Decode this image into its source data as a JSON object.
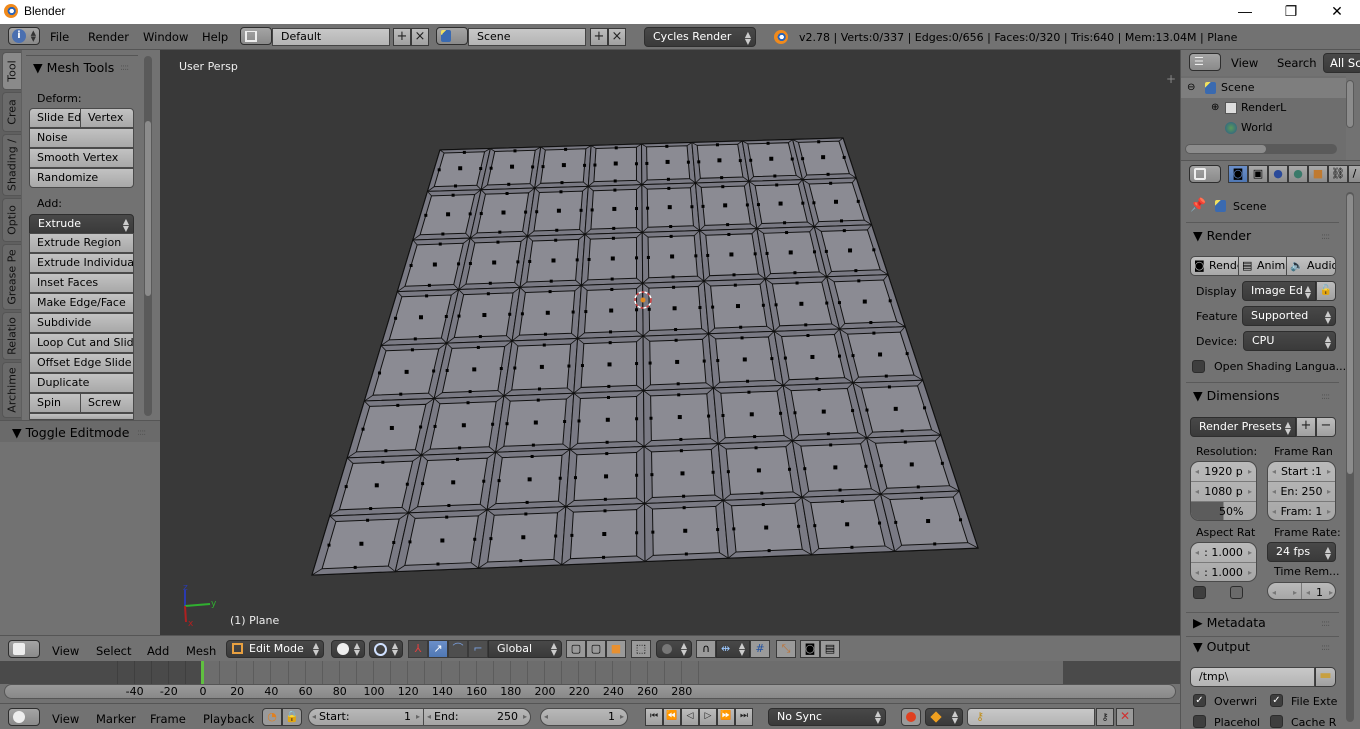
{
  "window": {
    "title": "Blender",
    "minimize": "—",
    "maximize": "❐",
    "close": "✕"
  },
  "topbar": {
    "menus": [
      "File",
      "Render",
      "Window",
      "Help"
    ],
    "layout": "Default",
    "scene": "Scene",
    "engine": "Cycles Render",
    "stats": "v2.78 | Verts:0/337 | Edges:0/656 | Faces:0/320 | Tris:640 | Mem:13.04M | Plane"
  },
  "toolshelf": {
    "tabs": [
      "Tool",
      "Crea",
      "Shading /",
      "Optio",
      "Grease Pe",
      "Relatio",
      "Archime"
    ],
    "panel_title": "Mesh Tools",
    "deform_label": "Deform:",
    "deform_buttons": [
      "Slide Ed",
      "Vertex",
      "Noise",
      "Smooth Vertex",
      "Randomize"
    ],
    "add_label": "Add:",
    "extrude_select": "Extrude",
    "add_buttons": [
      "Extrude Region",
      "Extrude Individual",
      "Inset Faces",
      "Make Edge/Face",
      "Subdivide",
      "Loop Cut and Slide",
      "Offset Edge Slide",
      "Duplicate"
    ],
    "spin": "Spin",
    "screw": "Screw",
    "toggle_editmode": "Toggle Editmode"
  },
  "viewport": {
    "view_label": "User Persp",
    "object_label": "(1) Plane",
    "axis": {
      "x": "x",
      "y": "y",
      "z": "z"
    }
  },
  "viewport_header": {
    "menus": [
      "View",
      "Select",
      "Add",
      "Mesh"
    ],
    "mode": "Edit Mode",
    "orientation": "Global"
  },
  "timeline": {
    "ticks": [
      "-40",
      "-20",
      "0",
      "20",
      "40",
      "60",
      "80",
      "100",
      "120",
      "140",
      "160",
      "180",
      "200",
      "220",
      "240",
      "260",
      "280"
    ],
    "current_frame": 0,
    "menus": [
      "View",
      "Marker",
      "Frame",
      "Playback"
    ],
    "start_label": "Start:",
    "start_value": "1",
    "end_label": "End:",
    "end_value": "250",
    "frame_value": "1",
    "sync": "No Sync"
  },
  "outliner": {
    "menus": [
      "View",
      "Search"
    ],
    "filter": "All Sc",
    "items": [
      "Scene",
      "RenderL",
      "World"
    ]
  },
  "properties": {
    "context": "Scene",
    "render_panel": {
      "title": "Render",
      "buttons": [
        "Rende",
        "Anima",
        "Audio"
      ],
      "display_label": "Display",
      "display_value": "Image Ed",
      "feature_label": "Feature",
      "feature_value": "Supported",
      "device_label": "Device:",
      "device_value": "CPU",
      "osl_label": "Open Shading Langua..."
    },
    "dimensions_panel": {
      "title": "Dimensions",
      "presets": "Render Presets",
      "resolution_label": "Resolution:",
      "res_x": "1920 p",
      "res_y": "1080 p",
      "res_pct": "50%",
      "res_pct_value": 0.5,
      "frame_range_label": "Frame Ran",
      "start": "Start :1",
      "end": "En: 250",
      "frame_step": "Fram: 1",
      "aspect_label": "Aspect Rat",
      "aspect_x": ": 1.000",
      "aspect_y": ": 1.000",
      "frame_rate_label": "Frame Rate:",
      "frame_rate": "24 fps",
      "time_remap_label": "Time Rem...",
      "time_remap_value": "1"
    },
    "metadata_title": "Metadata",
    "output_panel": {
      "title": "Output",
      "path": "/tmp\\",
      "overwrite": "Overwri",
      "overwrite_checked": true,
      "file_ext": "File Exte",
      "file_ext_checked": true,
      "placeholder": "Placehol",
      "cache": "Cache R"
    }
  },
  "colors": {
    "active_blue": "#5680c2",
    "frame_indicator": "#60c040",
    "mesh_face": "#8b8b93",
    "viewport_bg": "#393939"
  }
}
